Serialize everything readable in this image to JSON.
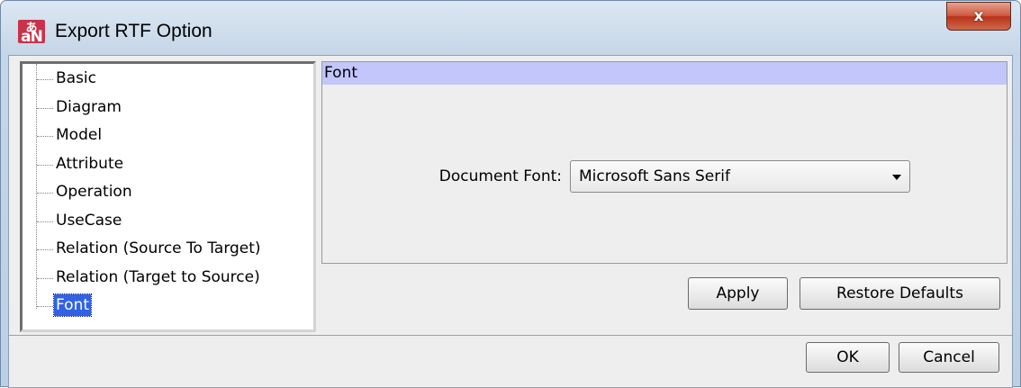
{
  "window": {
    "title": "Export RTF Option",
    "close_glyph": "x",
    "app_icon_top": "あ",
    "app_icon_bottom": "aN"
  },
  "tree": {
    "items": [
      {
        "label": "Basic"
      },
      {
        "label": "Diagram"
      },
      {
        "label": "Model"
      },
      {
        "label": "Attribute"
      },
      {
        "label": "Operation"
      },
      {
        "label": "UseCase"
      },
      {
        "label": "Relation (Source To Target)"
      },
      {
        "label": "Relation (Target to Source)"
      },
      {
        "label": "Font",
        "selected": true
      }
    ]
  },
  "panel": {
    "header": "Font",
    "document_font_label": "Document Font:",
    "document_font_value": "Microsoft Sans Serif"
  },
  "buttons": {
    "apply": "Apply",
    "restore_defaults": "Restore Defaults",
    "ok": "OK",
    "cancel": "Cancel"
  },
  "colors": {
    "panel_header_bg": "#c3c6fb",
    "selection_bg": "#3162e6",
    "close_button": "#c84a2e"
  }
}
